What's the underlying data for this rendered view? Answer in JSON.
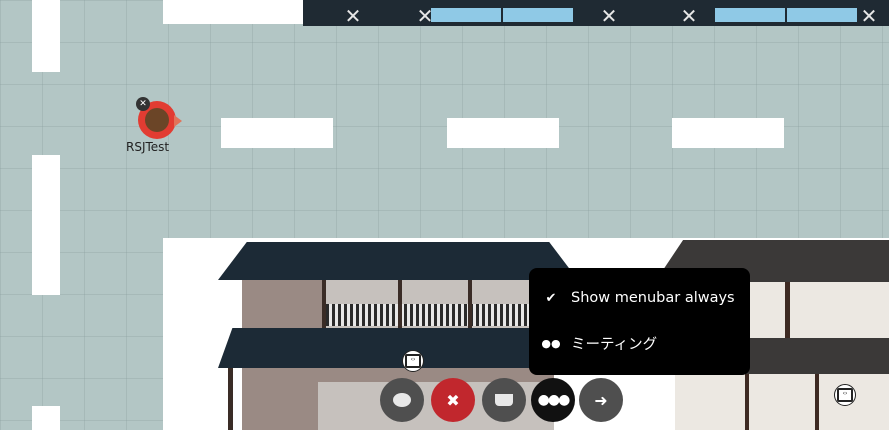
{
  "avatar": {
    "name": "RSJTest",
    "icon": "bear-avatar-icon",
    "status_icon": "mic-muted-icon"
  },
  "menu": {
    "items": [
      {
        "icon": "check-icon",
        "icon_glyph": "✔",
        "label": "Show menubar always"
      },
      {
        "icon": "users-icon",
        "icon_glyph": "👥",
        "label": "ミーティング"
      }
    ]
  },
  "toolbar": {
    "buttons": [
      {
        "name": "chat-button",
        "icon": "chat-bubble-icon",
        "glyph": "💬",
        "color": "#555555"
      },
      {
        "name": "microphone-button",
        "icon": "mic-off-icon",
        "glyph": "🎙",
        "color": "#c1272d"
      },
      {
        "name": "away-button",
        "icon": "coffee-cup-icon",
        "glyph": "☕",
        "color": "#555555"
      },
      {
        "name": "more-button",
        "icon": "more-dots-icon",
        "glyph": "•••",
        "color": "#111111"
      },
      {
        "name": "leave-button",
        "icon": "exit-door-icon",
        "glyph": "➜",
        "color": "#555555"
      }
    ]
  },
  "colors": {
    "menu_bg": "#000000",
    "map_bg": "#b3c6c5",
    "mic_off": "#c1272d"
  }
}
